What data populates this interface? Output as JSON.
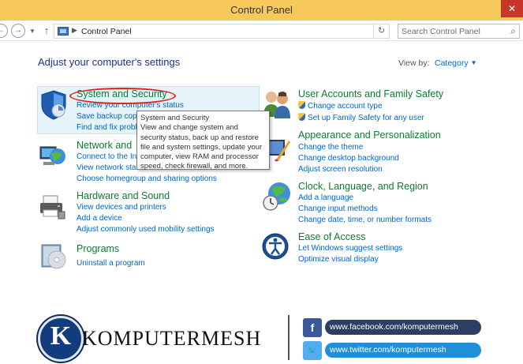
{
  "window": {
    "title": "Control Panel",
    "close_glyph": "✕"
  },
  "nav": {
    "back": "←",
    "forward": "→",
    "dropdown": "▾",
    "up": "↑",
    "refresh": "↻"
  },
  "address": {
    "separator": "▶",
    "path": "Control Panel"
  },
  "search": {
    "placeholder": "Search Control Panel",
    "icon": "⌕"
  },
  "main": {
    "heading": "Adjust your computer's settings",
    "view_by_label": "View by:",
    "view_by_value": "Category",
    "view_by_arrow": "▼"
  },
  "categories": [
    {
      "title": "System and Security",
      "icon": "shield-icon",
      "links": [
        "Review your computer's status",
        "Save backup copi",
        "Find and fix proble"
      ]
    },
    {
      "title": "Network and",
      "icon": "network-globe-icon",
      "links": [
        "Connect to the In",
        "View network stat",
        "Choose homegroup and sharing options"
      ]
    },
    {
      "title": "Hardware and Sound",
      "icon": "printer-icon",
      "links": [
        "View devices and printers",
        "Add a device",
        "Adjust commonly used mobility settings"
      ]
    },
    {
      "title": "Programs",
      "icon": "programs-disc-icon",
      "links": [
        "Uninstall a program"
      ]
    },
    {
      "title": "User Accounts and Family Safety",
      "icon": "users-icon",
      "links": [
        "Change account type",
        "Set up Family Safety for any user"
      ]
    },
    {
      "title": "Appearance and Personalization",
      "icon": "appearance-icon",
      "links": [
        "Change the theme",
        "Change desktop background",
        "Adjust screen resolution"
      ]
    },
    {
      "title": "Clock, Language, and Region",
      "icon": "clock-globe-icon",
      "links": [
        "Add a language",
        "Change input methods",
        "Change date, time, or number formats"
      ]
    },
    {
      "title": "Ease of Access",
      "icon": "ease-of-access-icon",
      "links": [
        "Let Windows suggest settings",
        "Optimize visual display"
      ]
    }
  ],
  "tooltip": {
    "title": "System and Security",
    "body": "View and change system and security status, back up and restore file and system settings, update your computer, view RAM and processor speed, check firewall, and more."
  },
  "branding": {
    "logo_letter": "K",
    "name": "KOMPUTERMESH",
    "facebook_glyph": "f",
    "twitter_glyph": "🐦",
    "facebook_url": "www.facebook.com/komputermesh",
    "twitter_url": "www.twitter.com/komputermesh"
  }
}
